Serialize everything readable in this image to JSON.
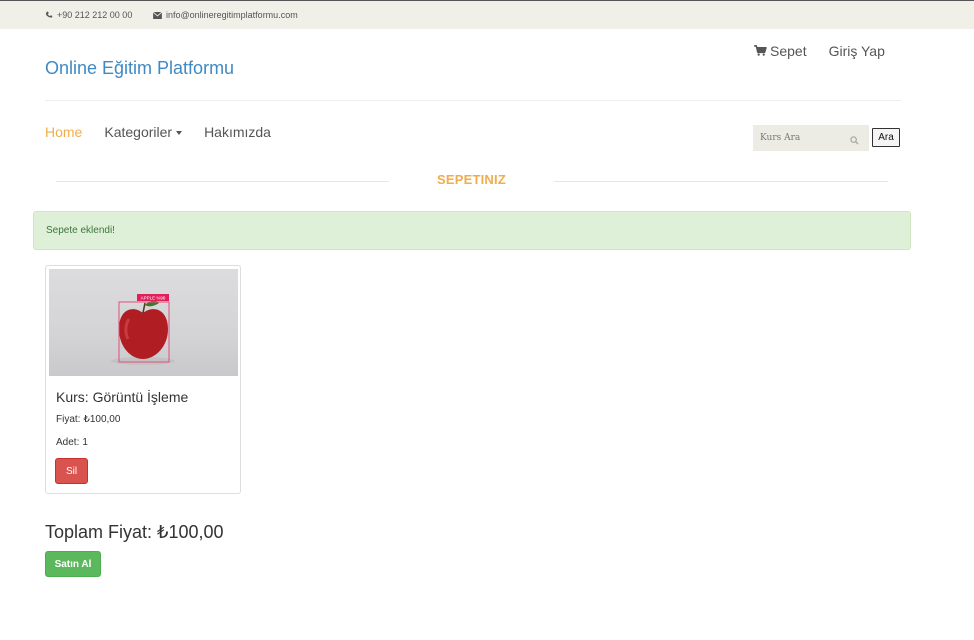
{
  "topbar": {
    "phone": "+90 212 212 00 00",
    "email": "info@onlineregitimplatformu.com"
  },
  "header": {
    "brand": "Online Eğitim Platformu",
    "cart_label": "Sepet",
    "login_label": "Giriş Yap"
  },
  "nav": {
    "items": [
      "Home",
      "Kategoriler",
      "Hakımızda"
    ],
    "search_placeholder": "Kurs Ara",
    "search_button": "Ara"
  },
  "section": {
    "title": "SEPETINIZ"
  },
  "alert": {
    "message": "Sepete eklendi!"
  },
  "cart": {
    "items": [
      {
        "title": "Kurs: Görüntü İşleme",
        "price_label": "Fiyat:",
        "price": "₺100,00",
        "qty_label": "Adet:",
        "qty": "1",
        "delete_label": "Sil",
        "image_tag": "APPLE %98"
      }
    ],
    "total_label": "Toplam Fiyat:",
    "total": "₺100,00",
    "buy_label": "Satın Al"
  },
  "colors": {
    "brand": "#3f8ac4",
    "accent": "#f0ad4e",
    "danger": "#d9534f",
    "success": "#5cb85c"
  }
}
